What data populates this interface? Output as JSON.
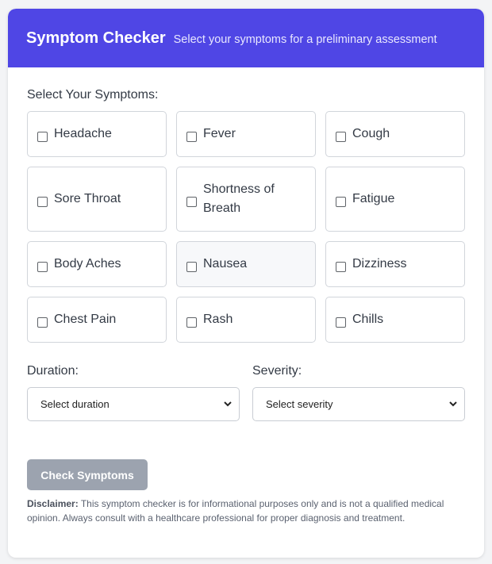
{
  "header": {
    "title": "Symptom Checker",
    "subtitle": "Select your symptoms for a preliminary assessment",
    "accent_color": "#4f46e5"
  },
  "symptoms": {
    "section_label": "Select Your Symptoms:",
    "items": [
      {
        "label": "Headache",
        "checked": false
      },
      {
        "label": "Fever",
        "checked": false
      },
      {
        "label": "Cough",
        "checked": false
      },
      {
        "label": "Sore Throat",
        "checked": false
      },
      {
        "label": "Shortness of Breath",
        "checked": false
      },
      {
        "label": "Fatigue",
        "checked": false
      },
      {
        "label": "Body Aches",
        "checked": false
      },
      {
        "label": "Nausea",
        "checked": false
      },
      {
        "label": "Dizziness",
        "checked": false
      },
      {
        "label": "Chest Pain",
        "checked": false
      },
      {
        "label": "Rash",
        "checked": false
      },
      {
        "label": "Chills",
        "checked": false
      }
    ]
  },
  "duration": {
    "label": "Duration:",
    "selected": "Select duration"
  },
  "severity": {
    "label": "Severity:",
    "selected": "Select severity"
  },
  "submit": {
    "label": "Check Symptoms",
    "disabled": true
  },
  "disclaimer": {
    "heading": "Disclaimer:",
    "text": "This symptom checker is for informational purposes only and is not a qualified medical opinion. Always consult with a healthcare professional for proper diagnosis and treatment."
  }
}
